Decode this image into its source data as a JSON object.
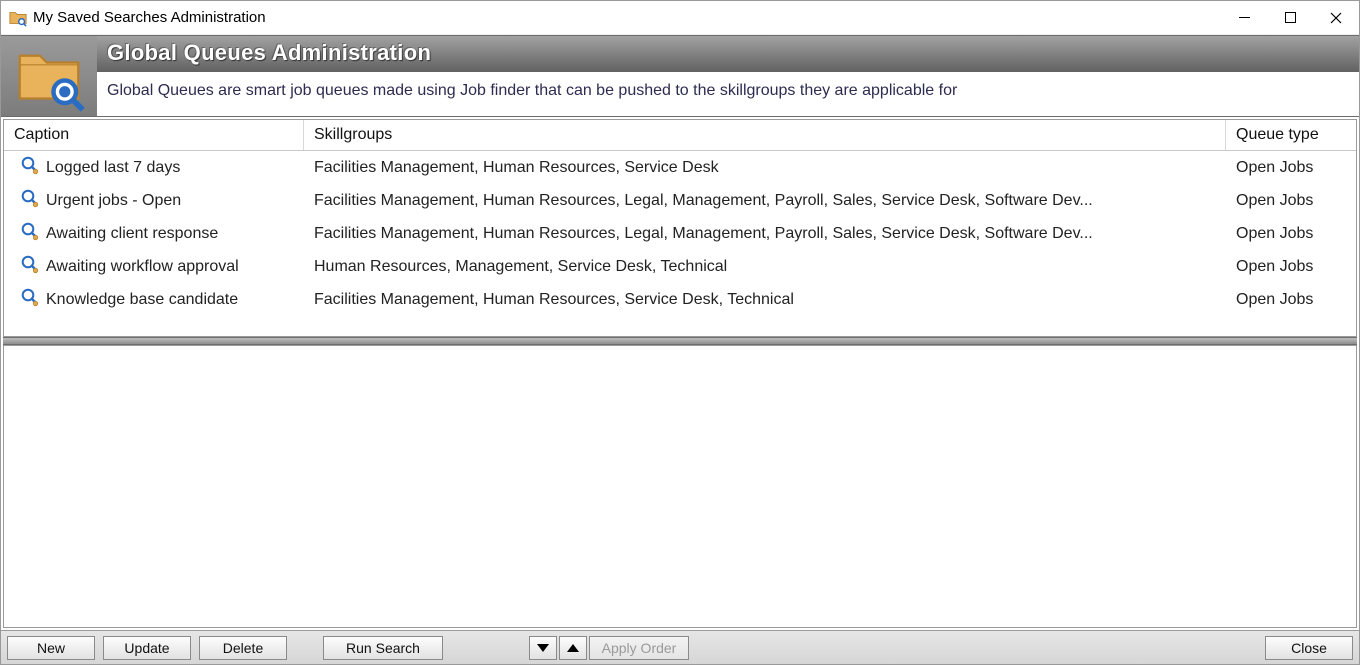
{
  "window": {
    "title": "My Saved Searches Administration"
  },
  "banner": {
    "heading": "Global Queues Administration",
    "subtitle": "Global Queues are smart job queues made using Job finder that can be pushed to the skillgroups they are applicable for"
  },
  "grid": {
    "headers": {
      "caption": "Caption",
      "skillgroups": "Skillgroups",
      "queue_type": "Queue type"
    },
    "rows": [
      {
        "caption": "Logged last 7 days",
        "skillgroups": "Facilities Management, Human Resources, Service Desk",
        "queue_type": "Open Jobs"
      },
      {
        "caption": "Urgent jobs - Open",
        "skillgroups": "Facilities Management, Human Resources, Legal, Management, Payroll, Sales, Service Desk, Software Dev...",
        "queue_type": "Open Jobs"
      },
      {
        "caption": "Awaiting client response",
        "skillgroups": "Facilities Management, Human Resources, Legal, Management, Payroll, Sales, Service Desk, Software Dev...",
        "queue_type": "Open Jobs"
      },
      {
        "caption": "Awaiting workflow approval",
        "skillgroups": "Human Resources, Management, Service Desk, Technical",
        "queue_type": "Open Jobs"
      },
      {
        "caption": "Knowledge base candidate",
        "skillgroups": "Facilities Management, Human Resources, Service Desk, Technical",
        "queue_type": "Open Jobs"
      }
    ]
  },
  "footer": {
    "new": "New",
    "update": "Update",
    "delete": "Delete",
    "run_search": "Run Search",
    "apply_order": "Apply Order",
    "close": "Close"
  }
}
